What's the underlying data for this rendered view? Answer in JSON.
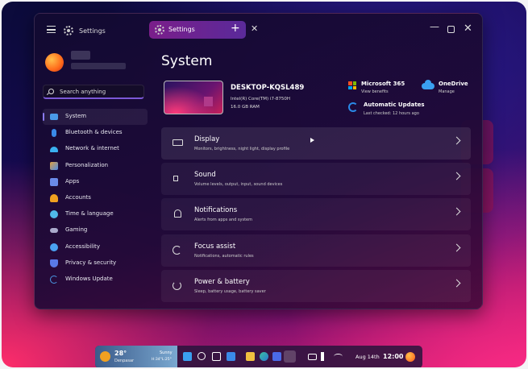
{
  "window": {
    "app_title": "Settings",
    "tab_label": "Settings",
    "tab_add": "+",
    "tab_close": "✕",
    "minimize": "—",
    "close": "✕"
  },
  "sidebar": {
    "search_placeholder": "Search anything",
    "items": [
      {
        "label": "System",
        "icon": "monitor-icon",
        "color": "#4a9ae8",
        "active": true
      },
      {
        "label": "Bluetooth & devices",
        "icon": "bluetooth-icon",
        "color": "#3a8ae8"
      },
      {
        "label": "Network & internet",
        "icon": "wifi-icon",
        "color": "#3ab0f0"
      },
      {
        "label": "Personalization",
        "icon": "brush-icon",
        "color": "#e0a040"
      },
      {
        "label": "Apps",
        "icon": "apps-icon",
        "color": "#6a8ae8"
      },
      {
        "label": "Accounts",
        "icon": "person-icon",
        "color": "#f0a020"
      },
      {
        "label": "Time & language",
        "icon": "globe-icon",
        "color": "#50b8e8"
      },
      {
        "label": "Gaming",
        "icon": "gamepad-icon",
        "color": "#aaaacc"
      },
      {
        "label": "Accessibility",
        "icon": "accessibility-icon",
        "color": "#4aa0f0"
      },
      {
        "label": "Privacy & security",
        "icon": "shield-icon",
        "color": "#5a7ae8"
      },
      {
        "label": "Windows Update",
        "icon": "update-icon",
        "color": "#4a9ae8"
      }
    ]
  },
  "main": {
    "title": "System",
    "device": {
      "name": "DESKTOP-KQSL489",
      "cpu": "Intel(R) Core(TM) i7-8750H",
      "ram": "16.0 GB RAM"
    },
    "microsoft365": {
      "title": "Microsoft 365",
      "sub": "View benefits"
    },
    "onedrive": {
      "title": "OneDrive",
      "sub": "Manage"
    },
    "updates": {
      "title": "Automatic Updates",
      "sub": "Last checked: 12 hours ago"
    },
    "cards": [
      {
        "title": "Display",
        "sub": "Monitors, brightness, night light, display profile",
        "icon": "laptop-icon"
      },
      {
        "title": "Sound",
        "sub": "Volume levels, output, input, sound devices",
        "icon": "speaker-icon"
      },
      {
        "title": "Notifications",
        "sub": "Alerts from apps and system",
        "icon": "bell-icon"
      },
      {
        "title": "Focus assist",
        "sub": "Notifications, automatic rules",
        "icon": "moon-icon"
      },
      {
        "title": "Power & battery",
        "sub": "Sleep, battery usage, battery saver",
        "icon": "power-icon"
      }
    ]
  },
  "taskbar": {
    "weather": {
      "temp": "28°",
      "city": "Denpasar",
      "condition": "Sunny",
      "hilo": "H:34°L:25°"
    },
    "date": "Aug 14th",
    "time": "12:00"
  }
}
